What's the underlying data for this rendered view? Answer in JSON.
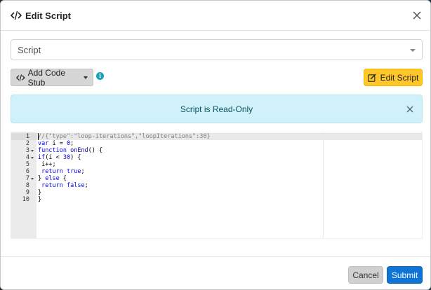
{
  "header": {
    "title": "Edit Script",
    "icon": "code-icon",
    "close_icon": "close-icon"
  },
  "script_select": {
    "value": "Script"
  },
  "toolbar": {
    "add_stub_label": "Add Code Stub",
    "edit_label": "Edit Script",
    "info_glyph": "i"
  },
  "alert": {
    "message": "Script is Read-Only"
  },
  "editor": {
    "lines": [
      {
        "n": "1",
        "fold": false,
        "text": "//{\"type\":\"loop-iterations\",\"loopIterations\":30}"
      },
      {
        "n": "2",
        "fold": false,
        "text": "var i = 0;"
      },
      {
        "n": "3",
        "fold": true,
        "text": "function onEnd() {"
      },
      {
        "n": "4",
        "fold": true,
        "text": "if(i < 30) {"
      },
      {
        "n": "5",
        "fold": false,
        "text": " i++;"
      },
      {
        "n": "6",
        "fold": false,
        "text": " return true;"
      },
      {
        "n": "7",
        "fold": true,
        "text": "} else {"
      },
      {
        "n": "8",
        "fold": false,
        "text": " return false;"
      },
      {
        "n": "9",
        "fold": false,
        "text": "}"
      },
      {
        "n": "10",
        "fold": false,
        "text": "}"
      }
    ]
  },
  "footer": {
    "cancel_label": "Cancel",
    "submit_label": "Submit"
  },
  "colors": {
    "edit_button": "#ffc72c",
    "submit_button": "#0f74d4",
    "alert_bg": "#d1f1fa",
    "info_icon": "#17a2b8"
  }
}
